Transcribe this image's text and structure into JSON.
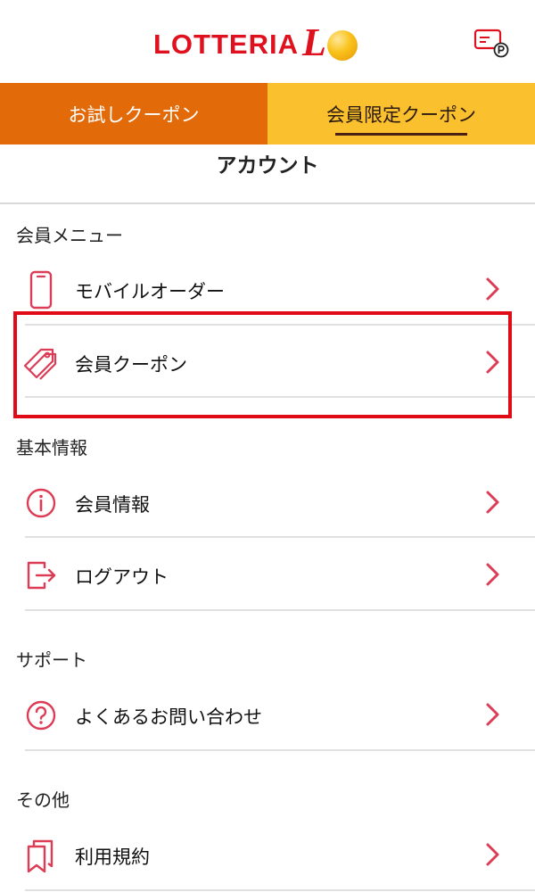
{
  "header": {
    "logo_text": "LOTTERIA",
    "logo_mark": "L",
    "points_card_icon": "points-card-icon"
  },
  "tabs": [
    {
      "label": "お試しクーポン",
      "selected": false
    },
    {
      "label": "会員限定クーポン",
      "selected": true
    }
  ],
  "page_title": "アカウント",
  "sections": {
    "member_menu": {
      "title": "会員メニュー",
      "items": [
        {
          "label": "モバイルオーダー",
          "icon": "smartphone-icon"
        },
        {
          "label": "会員クーポン",
          "icon": "coupon-tag-icon",
          "highlighted": true
        }
      ]
    },
    "basic_info": {
      "title": "基本情報",
      "items": [
        {
          "label": "会員情報",
          "icon": "info-icon"
        },
        {
          "label": "ログアウト",
          "icon": "logout-icon"
        }
      ]
    },
    "support": {
      "title": "サポート",
      "items": [
        {
          "label": "よくあるお問い合わせ",
          "icon": "question-icon"
        }
      ]
    },
    "other": {
      "title": "その他",
      "items": [
        {
          "label": "利用規約",
          "icon": "bookmark-icon"
        }
      ]
    }
  },
  "colors": {
    "brand_red": "#e0111f",
    "trial_tab_orange": "#e26a08",
    "member_tab_yellow": "#fbc02d",
    "icon_pink": "#dc3c55",
    "highlight_red": "#e00b16"
  }
}
